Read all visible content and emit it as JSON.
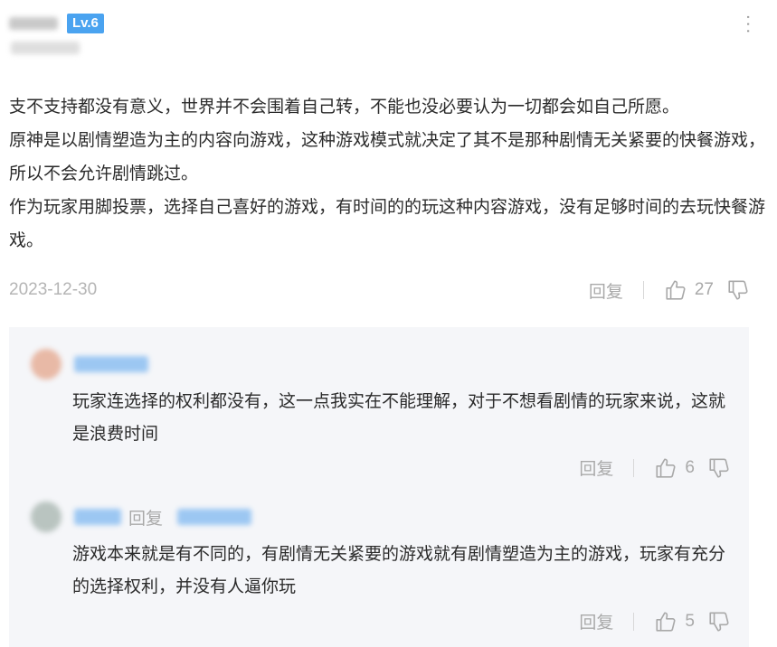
{
  "comment": {
    "level_badge": "Lv.6",
    "paragraphs": [
      "支不支持都没有意义，世界并不会围着自己转，不能也没必要认为一切都会如自己所愿。",
      "原神是以剧情塑造为主的内容向游戏，这种游戏模式就决定了其不是那种剧情无关紧要的快餐游戏，所以不会允许剧情跳过。",
      "作为玩家用脚投票，选择自己喜好的游戏，有时间的的玩这种内容游戏，没有足够时间的去玩快餐游戏。"
    ],
    "date": "2023-12-30",
    "reply_label": "回复",
    "like_count": "27"
  },
  "replies": [
    {
      "text": "玩家连选择的权利都没有，这一点我实在不能理解，对于不想看剧情的玩家来说，这就是浪费时间",
      "reply_label": "回复",
      "like_count": "6"
    },
    {
      "reply_to_label": "回复",
      "text": "游戏本来就是有不同的，有剧情无关紧要的游戏就有剧情塑造为主的游戏，玩家有充分的选择权利，并没有人逼你玩",
      "reply_label": "回复",
      "like_count": "5"
    }
  ],
  "colors": {
    "badge": "#4aa3f0",
    "reply_bg": "#f5f6f9",
    "muted_text": "#a9a9a9",
    "date_text": "#b5b5b5"
  },
  "icons": {
    "like": "thumbs-up-icon",
    "dislike": "thumbs-down-icon",
    "more": "more-vertical-icon"
  }
}
